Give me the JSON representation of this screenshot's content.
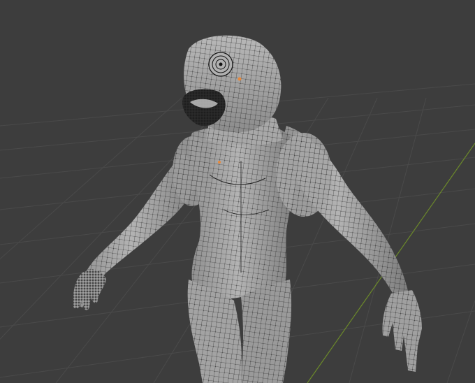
{
  "viewport": {
    "mode": "edit-mode",
    "object": "creature-mesh",
    "background_color": "#3d3d3d",
    "grid_color": "#4a4a4a",
    "axis_line_color": "#6c8a2a",
    "mesh_fill": "#a9a9a9",
    "mesh_shadow": "#6f6f6f",
    "wire_color": "#101010",
    "selected_vertex_color": "#e8893b"
  }
}
